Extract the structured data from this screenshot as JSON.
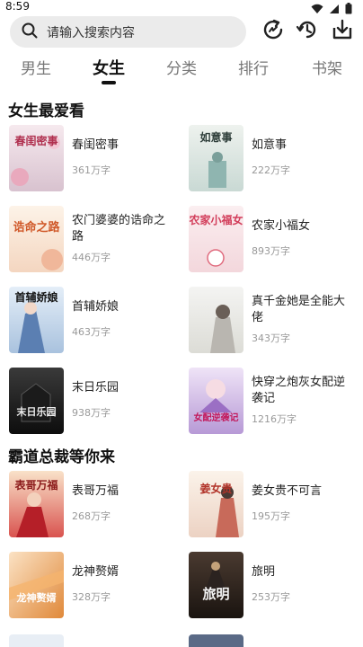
{
  "status": {
    "time": "8:59"
  },
  "search": {
    "placeholder": "请输入搜索内容"
  },
  "tabs": [
    {
      "label": "男生"
    },
    {
      "label": "女生"
    },
    {
      "label": "分类"
    },
    {
      "label": "排行"
    },
    {
      "label": "书架"
    }
  ],
  "sections": [
    {
      "title": "女生最爱看",
      "books": [
        {
          "title": "春闺密事",
          "count": "361万字",
          "cover_text": "春闺密事"
        },
        {
          "title": "如意事",
          "count": "222万字",
          "cover_text": "如意事"
        },
        {
          "title": "农门婆婆的诰命之路",
          "count": "446万字",
          "cover_text": "诰命之路"
        },
        {
          "title": "农家小福女",
          "count": "893万字",
          "cover_text": "农家小福女"
        },
        {
          "title": "首辅娇娘",
          "count": "463万字",
          "cover_text": "首辅娇娘"
        },
        {
          "title": "真千金她是全能大佬",
          "count": "343万字",
          "cover_text": ""
        },
        {
          "title": "末日乐园",
          "count": "938万字",
          "cover_text": "末日乐园"
        },
        {
          "title": "快穿之炮灰女配逆袭记",
          "count": "1216万字",
          "cover_text": "女配逆袭记"
        }
      ]
    },
    {
      "title": "霸道总裁等你来",
      "books": [
        {
          "title": "表哥万福",
          "count": "268万字",
          "cover_text": "表哥万福"
        },
        {
          "title": "姜女贵不可言",
          "count": "195万字",
          "cover_text": "姜女贵"
        },
        {
          "title": "龙神赘婿",
          "count": "328万字",
          "cover_text": "龙神赘婿"
        },
        {
          "title": "旅明",
          "count": "253万字",
          "cover_text": "旅明"
        }
      ]
    }
  ]
}
